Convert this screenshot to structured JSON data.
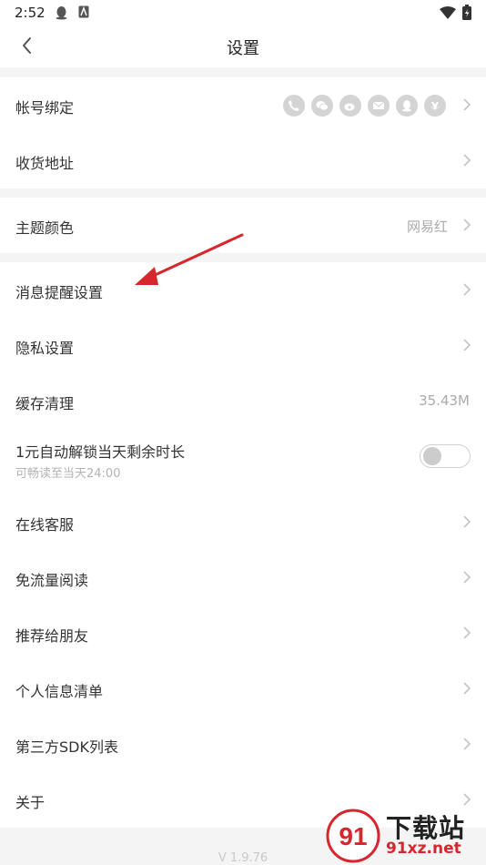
{
  "status": {
    "time": "2:52"
  },
  "header": {
    "title": "设置"
  },
  "groups": {
    "account": {
      "binding_label": "帐号绑定",
      "social_icons": [
        "phone-icon",
        "wechat-icon",
        "weibo-icon",
        "mail-icon",
        "qq-icon",
        "huawei-icon"
      ],
      "address_label": "收货地址"
    },
    "theme": {
      "label": "主题颜色",
      "value": "网易红"
    },
    "general": {
      "notification_label": "消息提醒设置",
      "privacy_label": "隐私设置",
      "cache_label": "缓存清理",
      "cache_value": "35.43M",
      "unlock_label": "1元自动解锁当天剩余时长",
      "unlock_sub": "可畅读至当天24:00",
      "unlock_enabled": false
    },
    "more": {
      "items": [
        "在线客服",
        "免流量阅读",
        "推荐给朋友",
        "个人信息清单",
        "第三方SDK列表",
        "关于"
      ]
    }
  },
  "footer": {
    "version": "V 1.9.76"
  },
  "watermark": {
    "title": "下载站",
    "site": "91xz.net",
    "logo_text": "91"
  },
  "colors": {
    "accent_red": "#d6262e",
    "toggle_off": "#cccccc"
  }
}
